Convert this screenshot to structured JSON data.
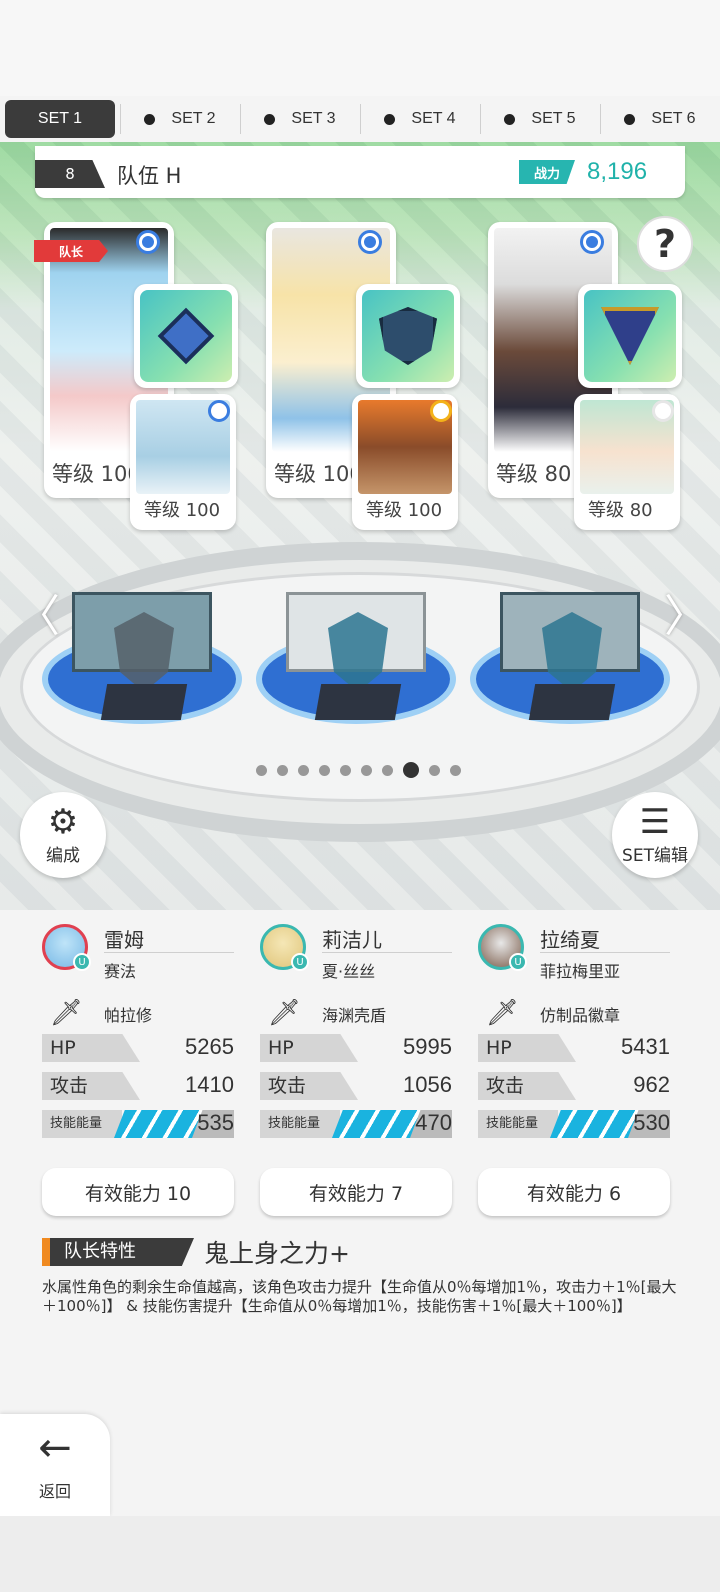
{
  "tabs": [
    {
      "label": "SET 1",
      "active": true
    },
    {
      "label": "SET 2",
      "active": false
    },
    {
      "label": "SET 3",
      "active": false
    },
    {
      "label": "SET 4",
      "active": false
    },
    {
      "label": "SET 5",
      "active": false
    },
    {
      "label": "SET 6",
      "active": false
    }
  ],
  "team": {
    "number": "8",
    "name": "队伍 H",
    "power_label": "战力",
    "power_value": "8,196"
  },
  "leader_tag": "队长",
  "help_icon": "?",
  "cards": [
    {
      "main_level": "等级 100",
      "sub_level": "等级 100"
    },
    {
      "main_level": "等级 100",
      "sub_level": "等级 100"
    },
    {
      "main_level": "等级 80",
      "sub_level": "等级 80"
    }
  ],
  "pager": {
    "count": 10,
    "active_index": 7
  },
  "buttons": {
    "formation": "编成",
    "set_edit": "SET编辑",
    "back": "返回"
  },
  "heroes": [
    {
      "name": "雷姆",
      "sub": "赛法",
      "equipment": "帕拉修",
      "hp_label": "HP",
      "hp": "5265",
      "atk_label": "攻击",
      "atk": "1410",
      "energy_label": "技能能量",
      "energy": "535",
      "ability": "有效能力 10"
    },
    {
      "name": "莉洁儿",
      "sub": "夏·丝丝",
      "equipment": "海渊壳盾",
      "hp_label": "HP",
      "hp": "5995",
      "atk_label": "攻击",
      "atk": "1056",
      "energy_label": "技能能量",
      "energy": "470",
      "ability": "有效能力 7"
    },
    {
      "name": "拉绮夏",
      "sub": "菲拉梅里亚",
      "equipment": "仿制品徽章",
      "hp_label": "HP",
      "hp": "5431",
      "atk_label": "攻击",
      "atk": "962",
      "energy_label": "技能能量",
      "energy": "530",
      "ability": "有效能力 6"
    }
  ],
  "leader_skill": {
    "heading": "队长特性",
    "title": "鬼上身之力+",
    "description": "水属性角色的剩余生命值越高，该角色攻击力提升【生命值从0％每增加1％，攻击力＋1％[最大＋100％]】 & 技能伤害提升【生命值从0％每增加1％，技能伤害＋1％[最大＋100％]】"
  },
  "colors": {
    "accent_teal": "#20b2aa",
    "leader_red": "#e23a3a",
    "energy_blue": "#1ab3df",
    "tab_active": "#3b3b3b"
  }
}
